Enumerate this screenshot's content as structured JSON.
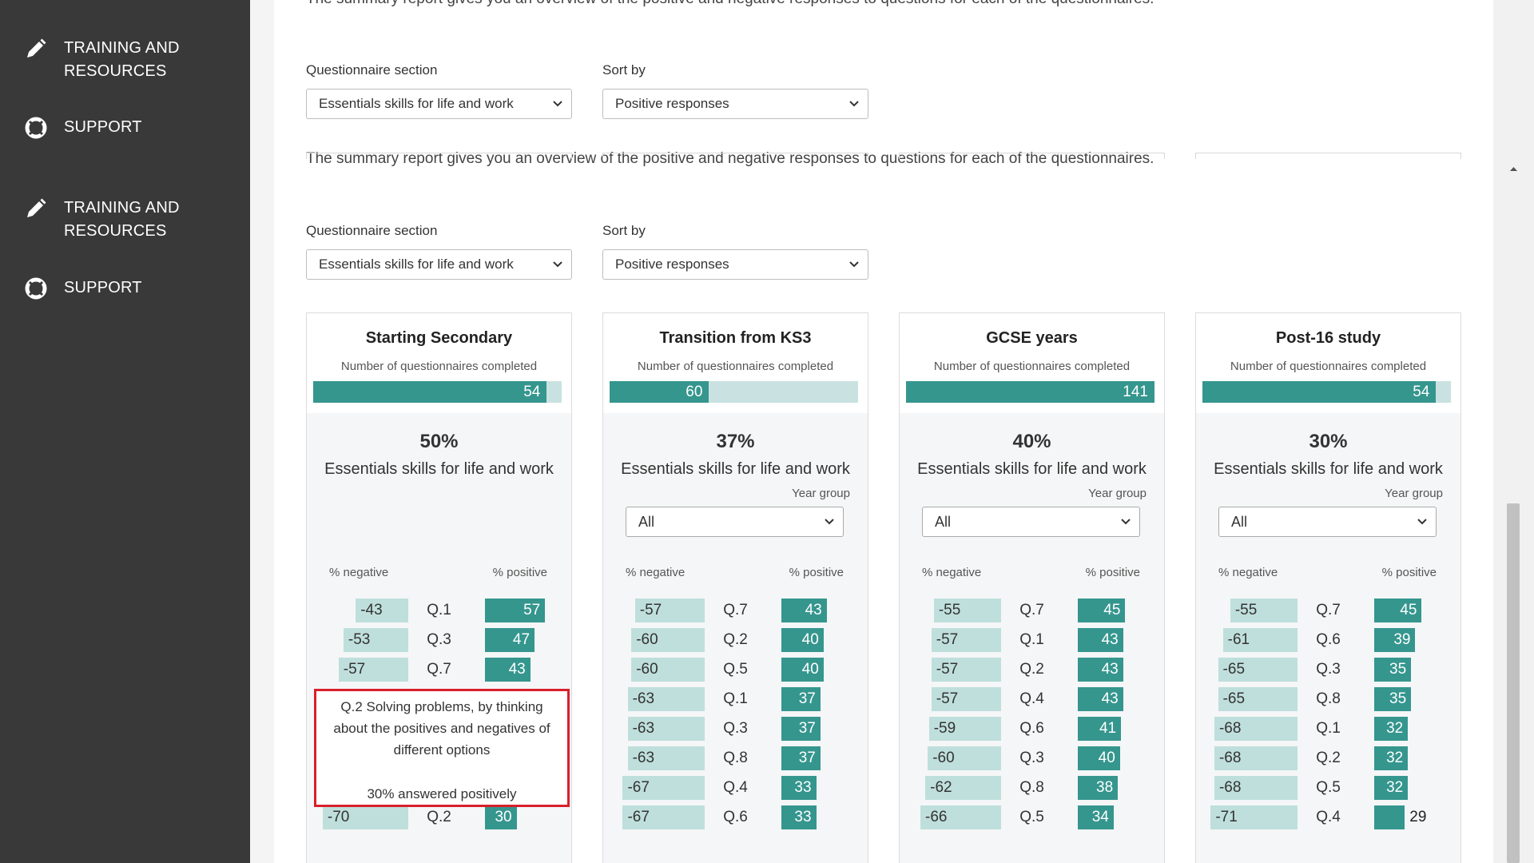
{
  "sidebar": {
    "items": [
      {
        "label": "TRAINING AND RESOURCES",
        "icon": "pencil-icon"
      },
      {
        "label": "SUPPORT",
        "icon": "lifebuoy-icon"
      },
      {
        "label": "TRAINING AND RESOURCES",
        "icon": "pencil-icon"
      },
      {
        "label": "SUPPORT",
        "icon": "lifebuoy-icon"
      }
    ]
  },
  "intro": {
    "text": "The summary report gives you an overview of the positive and negative responses to questions for each of the questionnaires."
  },
  "filters": {
    "section_label": "Questionnaire section",
    "section_value": "Essentials skills for life and work",
    "sort_label": "Sort by",
    "sort_value": "Positive responses"
  },
  "colors": {
    "accent": "#35968e",
    "accent_light": "#c9e2e1",
    "negative": "#bfdfdc",
    "sidebar": "#393939",
    "tooltip_border": "#d8202b"
  },
  "common": {
    "questionnaires_label": "Number of questionnaires completed",
    "year_group_label": "Year group",
    "year_group_value": "All",
    "neg_header": "% negative",
    "pos_header": "% positive"
  },
  "cards": [
    {
      "title": "Starting Secondary",
      "count": 54,
      "count_fraction": 0.94,
      "percent": "50%",
      "section": "Essentials skills for life and work",
      "has_year_group": false,
      "rows": [
        {
          "neg": -43,
          "q": "Q.1",
          "pos": 57
        },
        {
          "neg": -53,
          "q": "Q.3",
          "pos": 47
        },
        {
          "neg": -57,
          "q": "Q.7",
          "pos": 43
        },
        {
          "neg": -70,
          "q": "Q.2",
          "pos": 30
        }
      ]
    },
    {
      "title": "Transition from KS3",
      "count": 60,
      "count_fraction": 0.4,
      "percent": "37%",
      "section": "Essentials skills for life and work",
      "has_year_group": true,
      "rows": [
        {
          "neg": -57,
          "q": "Q.7",
          "pos": 43
        },
        {
          "neg": -60,
          "q": "Q.2",
          "pos": 40
        },
        {
          "neg": -60,
          "q": "Q.5",
          "pos": 40
        },
        {
          "neg": -63,
          "q": "Q.1",
          "pos": 37
        },
        {
          "neg": -63,
          "q": "Q.3",
          "pos": 37
        },
        {
          "neg": -63,
          "q": "Q.8",
          "pos": 37
        },
        {
          "neg": -67,
          "q": "Q.4",
          "pos": 33
        },
        {
          "neg": -67,
          "q": "Q.6",
          "pos": 33
        }
      ]
    },
    {
      "title": "GCSE years",
      "count": 141,
      "count_fraction": 1.0,
      "percent": "40%",
      "section": "Essentials skills for life and work",
      "has_year_group": true,
      "rows": [
        {
          "neg": -55,
          "q": "Q.7",
          "pos": 45
        },
        {
          "neg": -57,
          "q": "Q.1",
          "pos": 43
        },
        {
          "neg": -57,
          "q": "Q.2",
          "pos": 43
        },
        {
          "neg": -57,
          "q": "Q.4",
          "pos": 43
        },
        {
          "neg": -59,
          "q": "Q.6",
          "pos": 41
        },
        {
          "neg": -60,
          "q": "Q.3",
          "pos": 40
        },
        {
          "neg": -62,
          "q": "Q.8",
          "pos": 38
        },
        {
          "neg": -66,
          "q": "Q.5",
          "pos": 34
        }
      ]
    },
    {
      "title": "Post-16 study",
      "count": 54,
      "count_fraction": 0.94,
      "percent": "30%",
      "section": "Essentials skills for life and work",
      "has_year_group": true,
      "rows": [
        {
          "neg": -55,
          "q": "Q.7",
          "pos": 45
        },
        {
          "neg": -61,
          "q": "Q.6",
          "pos": 39
        },
        {
          "neg": -65,
          "q": "Q.3",
          "pos": 35
        },
        {
          "neg": -65,
          "q": "Q.8",
          "pos": 35
        },
        {
          "neg": -68,
          "q": "Q.1",
          "pos": 32
        },
        {
          "neg": -68,
          "q": "Q.2",
          "pos": 32
        },
        {
          "neg": -68,
          "q": "Q.5",
          "pos": 32
        },
        {
          "neg": -71,
          "q": "Q.4",
          "pos": 29
        }
      ]
    }
  ],
  "tooltip": {
    "text": "Q.2 Solving problems, by thinking about the positives and negatives of different options",
    "pct_text": "30% answered positively"
  }
}
